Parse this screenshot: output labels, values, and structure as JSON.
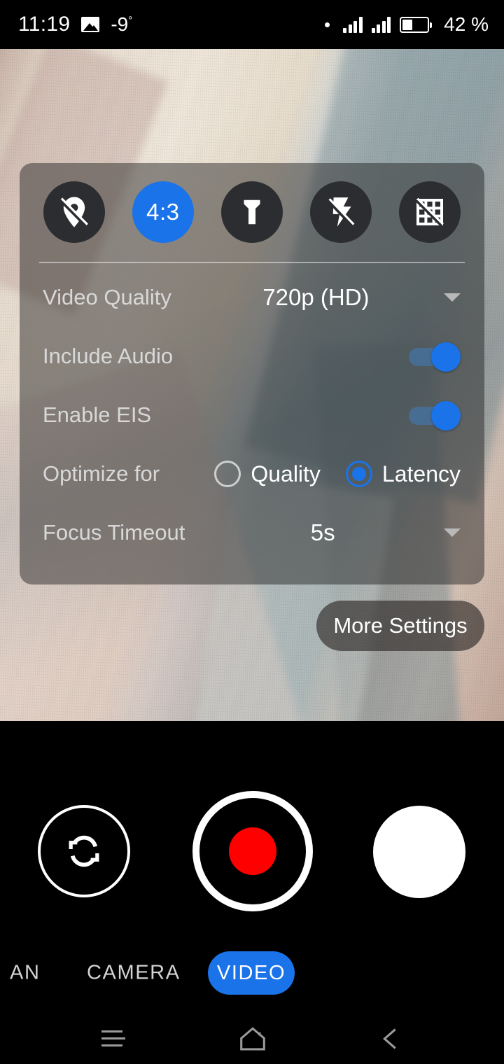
{
  "statusbar": {
    "time": "11:19",
    "image_icon": "image-icon",
    "temperature": "-9",
    "degree_symbol": "°",
    "dot_icon": "dot-indicator-icon",
    "signal_icon_1": "signal-bars-icon",
    "signal_icon_2": "signal-bars-icon",
    "battery_icon": "battery-icon",
    "battery_percent": "42 %"
  },
  "settings_panel": {
    "quick_icons": [
      {
        "name": "location-off-icon",
        "label": "",
        "active": false
      },
      {
        "name": "aspect-ratio-icon",
        "label": "4:3",
        "active": true
      },
      {
        "name": "torch-icon",
        "label": "",
        "active": false
      },
      {
        "name": "flash-off-icon",
        "label": "",
        "active": false
      },
      {
        "name": "grid-off-icon",
        "label": "",
        "active": false
      }
    ],
    "rows": {
      "video_quality": {
        "label": "Video Quality",
        "value": "720p (HD)",
        "caret": "chevron-down-icon"
      },
      "include_audio": {
        "label": "Include Audio",
        "state": "on"
      },
      "enable_eis": {
        "label": "Enable EIS",
        "state": "on"
      },
      "optimize_for": {
        "label": "Optimize for",
        "options": [
          {
            "label": "Quality",
            "selected": false
          },
          {
            "label": "Latency",
            "selected": true
          }
        ]
      },
      "focus_timeout": {
        "label": "Focus Timeout",
        "value": "5s",
        "caret": "chevron-down-icon"
      }
    }
  },
  "more_settings_button": {
    "label": "More Settings"
  },
  "camera_controls": {
    "switch_camera": "switch-camera-icon",
    "record_button": "record-button",
    "gallery_thumbnail": "gallery-thumbnail"
  },
  "mode_tabs": [
    {
      "label": "AN",
      "active": false,
      "name": "tab-scan"
    },
    {
      "label": "CAMERA",
      "active": false,
      "name": "tab-camera"
    },
    {
      "label": "VIDEO",
      "active": true,
      "name": "tab-video"
    }
  ],
  "navbar": {
    "recents": "recents-icon",
    "home": "home-icon",
    "back": "back-icon"
  },
  "colors": {
    "accent_blue": "#1a73e8",
    "record_red": "#fe0000",
    "panel_bg": "rgba(28,28,28,0.46)",
    "icon_bg": "#2b2d30",
    "label_gray": "#d8d8d8",
    "white": "#ffffff",
    "black": "#000000"
  }
}
